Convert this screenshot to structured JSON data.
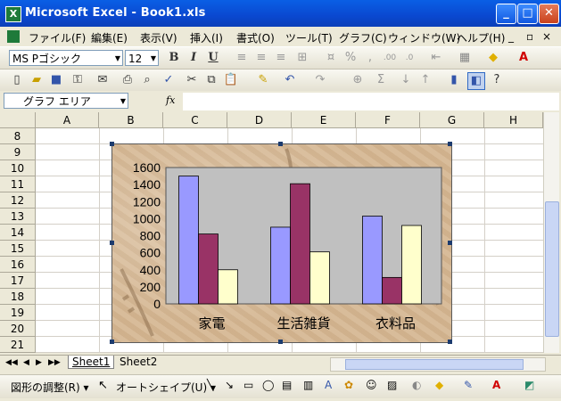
{
  "window": {
    "title": "Microsoft Excel - Book1.xls",
    "minimize": "_",
    "maximize": "□",
    "close": "✕"
  },
  "menu": {
    "items": [
      "ファイル(F)",
      "編集(E)",
      "表示(V)",
      "挿入(I)",
      "書式(O)",
      "ツール(T)",
      "グラフ(C)",
      "ウィンドウ(W)",
      "ヘルプ(H)"
    ],
    "doc_min": "_",
    "doc_restore": "▫",
    "doc_close": "×"
  },
  "format_toolbar": {
    "font": "MS Pゴシック",
    "size": "12",
    "bold": "B",
    "italic": "I",
    "underline": "U",
    "percent": "%",
    "comma": ",",
    "dec_inc": ".00",
    "dec_dec": ".0"
  },
  "formula_bar": {
    "name_box": "グラフ エリア",
    "fx": "fx",
    "value": ""
  },
  "columns": [
    "A",
    "B",
    "C",
    "D",
    "E",
    "F",
    "G",
    "H"
  ],
  "rows": [
    "8",
    "9",
    "10",
    "11",
    "12",
    "13",
    "14",
    "15",
    "16",
    "17",
    "18",
    "19",
    "20",
    "21"
  ],
  "sheet_tabs": [
    "Sheet1",
    "Sheet2"
  ],
  "draw_toolbar": {
    "adjust": "図形の調整(R) ▾",
    "autoshape": "オートシェイプ(U) ▾"
  },
  "chart_data": {
    "type": "bar",
    "categories": [
      "家電",
      "生活雑貨",
      "衣料品"
    ],
    "series": [
      {
        "values": [
          1500,
          900,
          1030
        ],
        "color": "#9999ff"
      },
      {
        "values": [
          820,
          1410,
          310
        ],
        "color": "#993366"
      },
      {
        "values": [
          400,
          610,
          920
        ],
        "color": "#ffffcc"
      }
    ],
    "ylim": [
      0,
      1600
    ],
    "yticks": [
      0,
      200,
      400,
      600,
      800,
      1000,
      1200,
      1400,
      1600
    ],
    "plot_bg": "#c0c0c0",
    "legend": "none",
    "grid": false
  }
}
